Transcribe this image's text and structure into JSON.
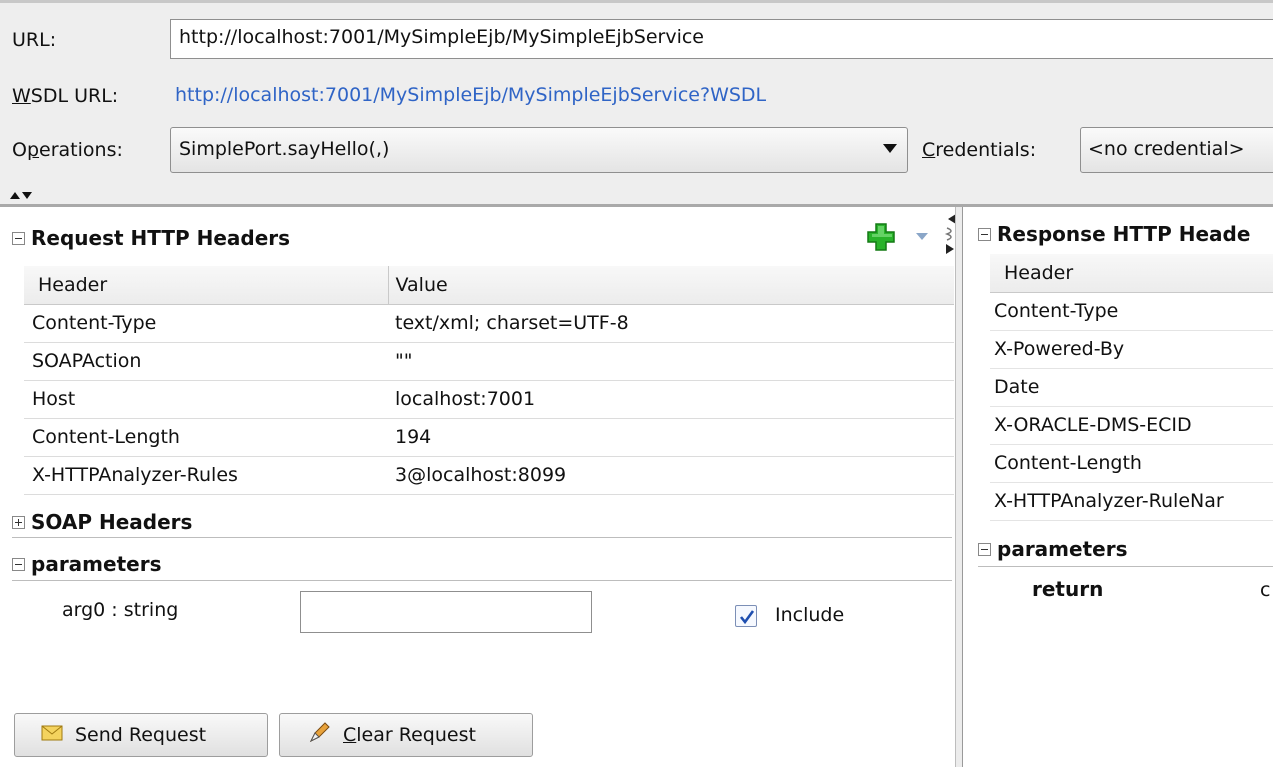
{
  "header": {
    "url_label": "URL:",
    "url_value": "http://localhost:7001/MySimpleEjb/MySimpleEjbService",
    "wsdl_label_prefix": "W",
    "wsdl_label_rest": "SDL URL:",
    "wsdl_url": "http://localhost:7001/MySimpleEjb/MySimpleEjbService?WSDL",
    "operations_label_prefix": "O",
    "operations_label_p": "p",
    "operations_label_rest": "erations:",
    "operation_selected": "SimplePort.sayHello(,)",
    "credentials_label_prefix": "C",
    "credentials_label_rest": "redentials:",
    "credential_selected": "<no credential>"
  },
  "request": {
    "http_headers_title": "Request HTTP Headers",
    "columns": [
      "Header",
      "Value"
    ],
    "rows": [
      {
        "header": "Content-Type",
        "value": "text/xml; charset=UTF-8"
      },
      {
        "header": "SOAPAction",
        "value": "\"\""
      },
      {
        "header": "Host",
        "value": "localhost:7001"
      },
      {
        "header": "Content-Length",
        "value": "194"
      },
      {
        "header": "X-HTTPAnalyzer-Rules",
        "value": "3@localhost:8099"
      }
    ],
    "soap_headers_title": "SOAP Headers",
    "parameters_title": "parameters",
    "arg0_label": "arg0 : string",
    "arg0_value": "",
    "include_label": "Include",
    "include_checked": true,
    "send_button": "Send Request",
    "clear_button_prefix": "C",
    "clear_button_rest": "lear Request"
  },
  "response": {
    "http_headers_title": "Response HTTP Heade",
    "column": "Header",
    "rows": [
      "Content-Type",
      "X-Powered-By",
      "Date",
      "X-ORACLE-DMS-ECID",
      "Content-Length",
      "X-HTTPAnalyzer-RuleNar"
    ],
    "parameters_title": "parameters",
    "return_label": "return",
    "return_value": "c"
  },
  "colors": {
    "link": "#2f64c6",
    "add_icon": "#1fa51f",
    "checkbox_check": "#1f4fb0"
  }
}
